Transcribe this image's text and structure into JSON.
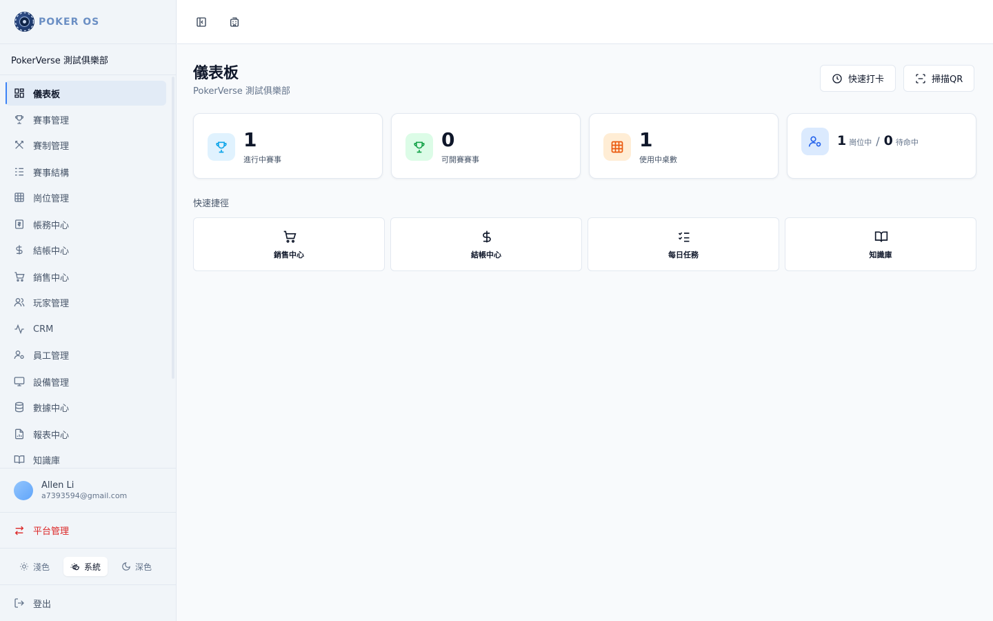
{
  "brand": {
    "name": "POKER OS"
  },
  "club_name": "PokerVerse 測試俱樂部",
  "nav": {
    "items": [
      {
        "label": "儀表板",
        "icon": "layout-grid-icon",
        "active": true
      },
      {
        "label": "賽事管理",
        "icon": "trophy-icon",
        "active": false
      },
      {
        "label": "賽制管理",
        "icon": "swords-icon",
        "active": false
      },
      {
        "label": "賽事結構",
        "icon": "list-tree-icon",
        "active": false
      },
      {
        "label": "崗位管理",
        "icon": "table-grid-icon",
        "active": false
      },
      {
        "label": "帳務中心",
        "icon": "receipt-icon",
        "active": false
      },
      {
        "label": "結帳中心",
        "icon": "dollar-icon",
        "active": false
      },
      {
        "label": "銷售中心",
        "icon": "cart-icon",
        "active": false
      },
      {
        "label": "玩家管理",
        "icon": "users-icon",
        "active": false
      },
      {
        "label": "CRM",
        "icon": "activity-icon",
        "active": false
      },
      {
        "label": "員工管理",
        "icon": "user-cog-icon",
        "active": false
      },
      {
        "label": "設備管理",
        "icon": "monitor-icon",
        "active": false
      },
      {
        "label": "數據中心",
        "icon": "database-icon",
        "active": false
      },
      {
        "label": "報表中心",
        "icon": "file-chart-icon",
        "active": false
      },
      {
        "label": "知識庫",
        "icon": "book-open-icon",
        "active": false
      }
    ]
  },
  "user": {
    "name": "Allen Li",
    "email": "a7393594@gmail.com"
  },
  "platform_label": "平台管理",
  "theme": {
    "light": "淺色",
    "system": "系統",
    "dark": "深色",
    "selected": "system"
  },
  "logout_label": "登出",
  "page": {
    "title": "儀表板",
    "subtitle": "PokerVerse 測試俱樂部",
    "actions": {
      "clock_in": "快速打卡",
      "scan_qr": "掃描QR"
    }
  },
  "stats": [
    {
      "value": "1",
      "label": "進行中賽事",
      "icon": "trophy-icon",
      "color": "#0ea5e9"
    },
    {
      "value": "0",
      "label": "可開賽賽事",
      "icon": "trophy-icon",
      "color": "#16a34a"
    },
    {
      "value": "1",
      "label": "使用中桌數",
      "icon": "table-grid-icon",
      "color": "#ea580c"
    }
  ],
  "seats": {
    "on_duty": "1",
    "on_duty_label": "崗位中",
    "separator": "/",
    "waiting": "0",
    "waiting_label": "待命中",
    "icon": "user-cog-icon",
    "color": "#2563eb"
  },
  "shortcuts": {
    "title": "快速捷徑",
    "items": [
      {
        "label": "銷售中心",
        "icon": "cart-icon"
      },
      {
        "label": "結帳中心",
        "icon": "dollar-icon"
      },
      {
        "label": "每日任務",
        "icon": "list-checks-icon"
      },
      {
        "label": "知識庫",
        "icon": "book-open-icon"
      }
    ]
  }
}
